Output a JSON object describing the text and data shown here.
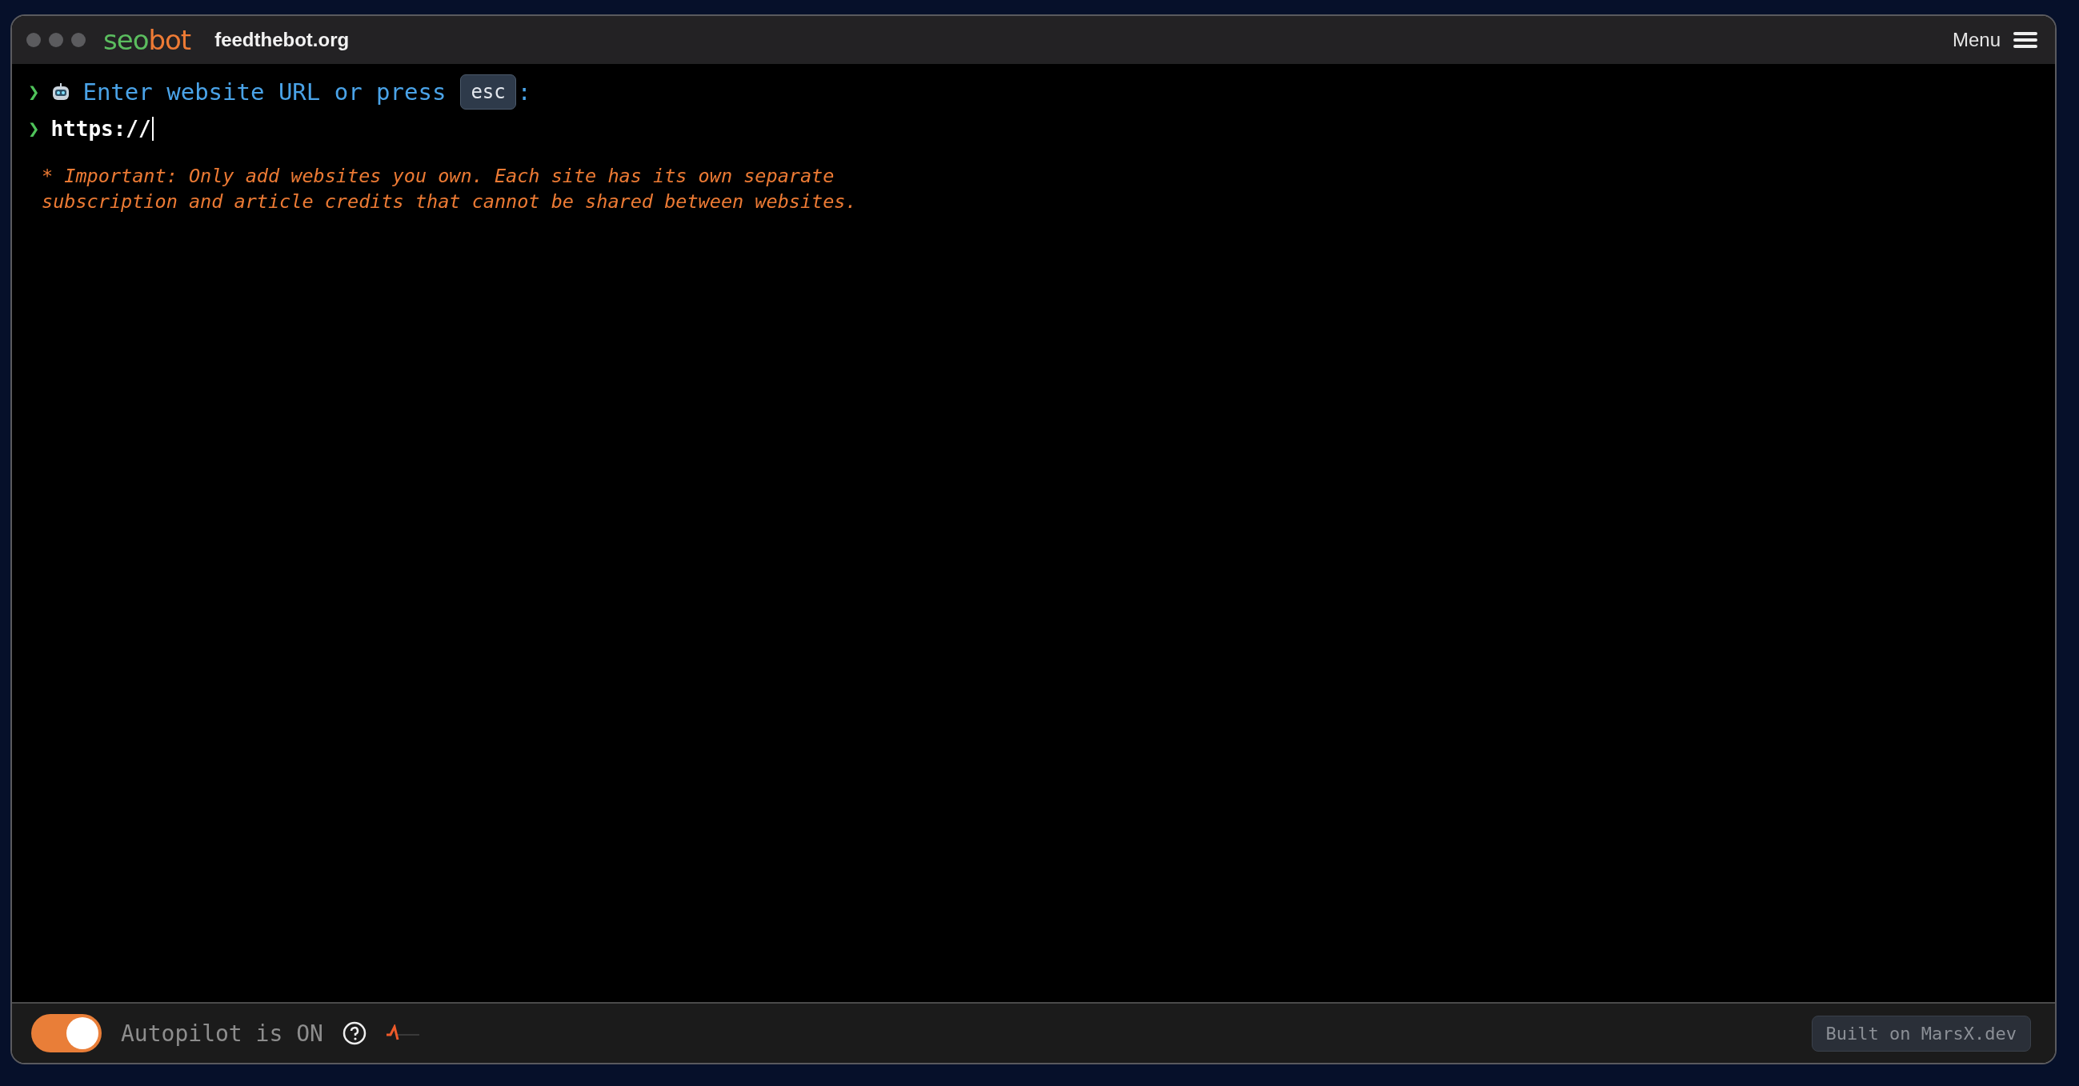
{
  "window": {
    "logo": {
      "part_1": "seo",
      "part_2": "bot"
    },
    "site": "feedthebot.org",
    "menu": "Menu"
  },
  "terminal": {
    "lines": [
      {
        "kind": "prompt",
        "prompt": "❯",
        "text": "Enter website URL or press",
        "key": "esc",
        "suffix": ":"
      },
      {
        "kind": "input",
        "prompt": "❯",
        "value": "https://"
      }
    ],
    "note": "* Important: Only add websites you own. Each site has its own separate subscription and article credits that cannot be shared between websites."
  },
  "footer": {
    "autopilot": {
      "on": true,
      "label": "Autopilot is ON"
    },
    "credit": "Built on MarsX.dev"
  }
}
